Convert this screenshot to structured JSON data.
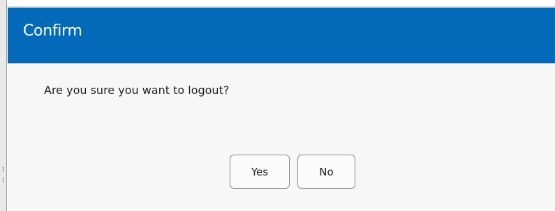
{
  "dialog": {
    "title": "Confirm",
    "message": "Are you sure you want to logout?",
    "yes_label": "Yes",
    "no_label": "No"
  },
  "colors": {
    "titlebar": "#0369b9",
    "dialog_background": "#f7f7f7",
    "button_border": "#8a8a8a"
  }
}
